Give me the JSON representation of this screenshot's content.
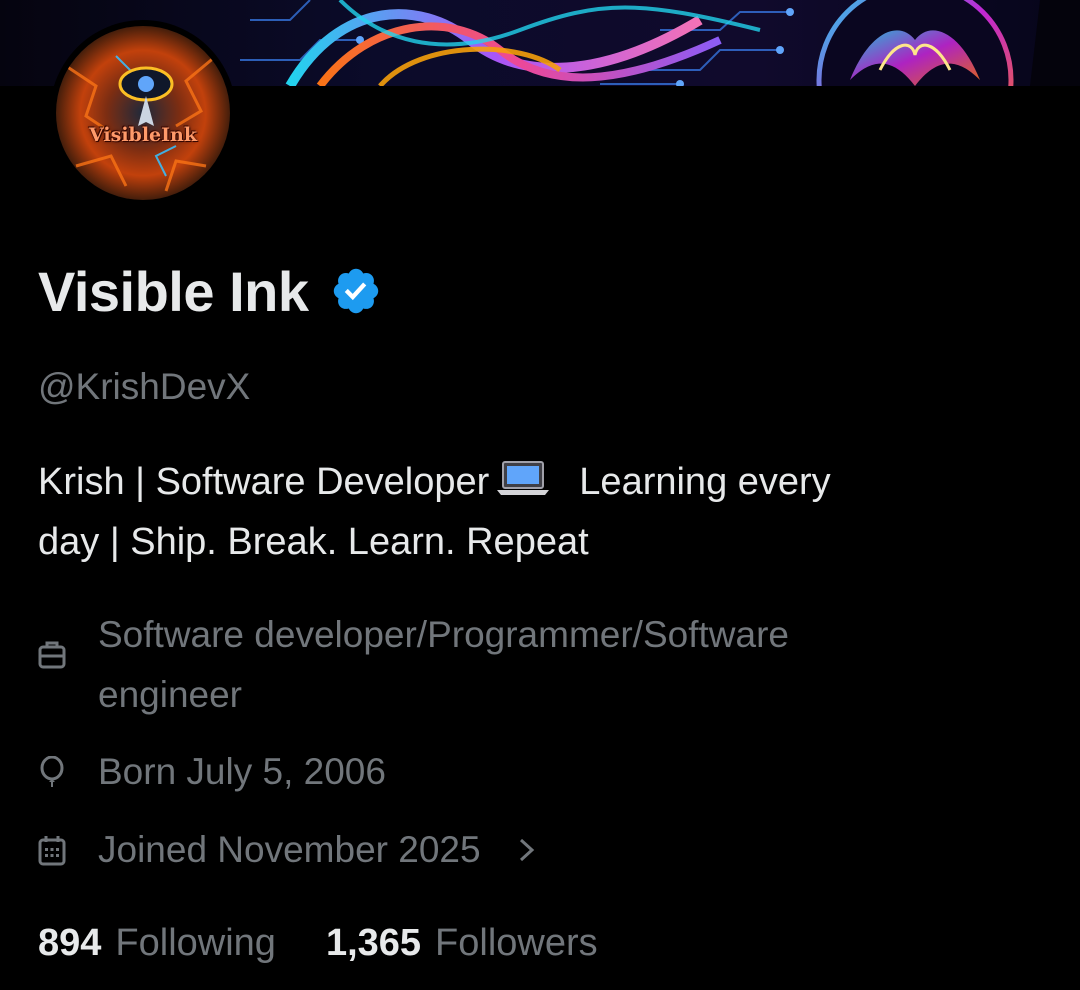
{
  "profile": {
    "display_name": "Visible Ink",
    "verified": true,
    "handle": "@KrishDevX",
    "avatar_text": "VisibleInk",
    "bio_line1_part1": "Krish | Software Developer",
    "bio_line1_part2": "Learning every",
    "bio_line2": "day | Ship. Break. Learn. Repeat",
    "job_line1": "Software developer/Programmer/Software",
    "job_line2": "engineer",
    "birthday": "Born July 5, 2006",
    "joined": "Joined November 2025",
    "following_count": "894",
    "following_label": "Following",
    "followers_count": "1,365",
    "followers_label": "Followers"
  },
  "icons": {
    "verified": "verified-badge-icon",
    "laptop": "laptop-emoji-icon",
    "job": "briefcase-icon",
    "born": "balloon-icon",
    "joined": "calendar-icon",
    "chevron": "chevron-right-icon"
  },
  "colors": {
    "background": "#000000",
    "primary_text": "#e7e9ea",
    "secondary_text": "#71767b",
    "verified_blue": "#1d9bf0"
  }
}
